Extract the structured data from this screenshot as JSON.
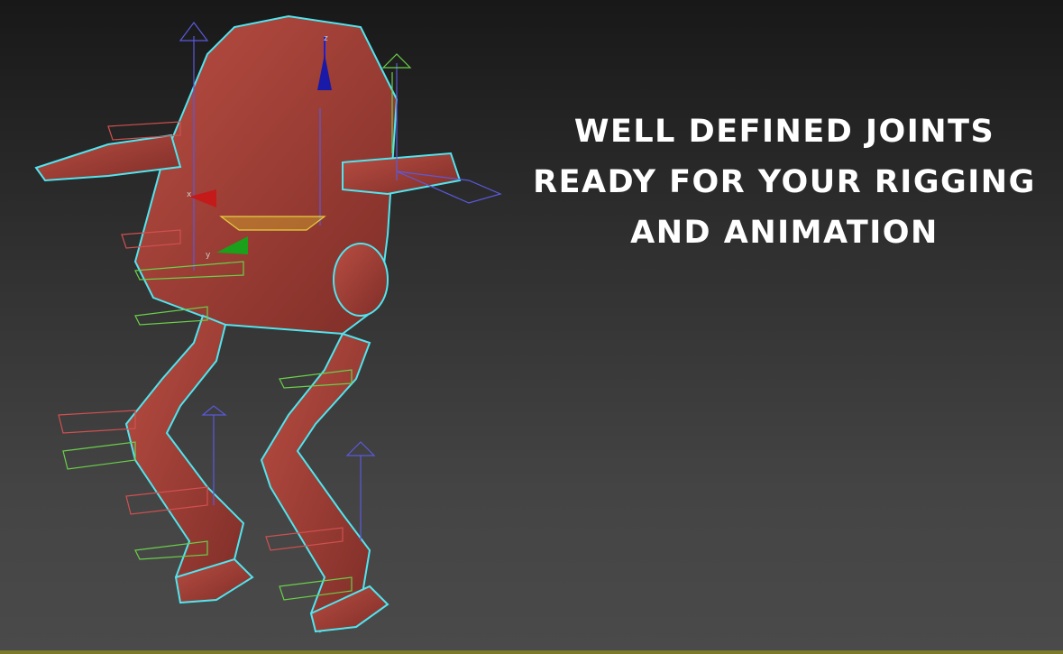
{
  "headline": {
    "lines": [
      "WELL DEFINED JOINTS",
      "READY FOR YOUR RIGGING",
      "AND ANIMATION"
    ]
  },
  "colors": {
    "model": "#a8433a",
    "selection_outline": "#4fe6f0",
    "bone_blue": "#5a5adc",
    "bone_green": "#6ad04a",
    "bone_red": "#d05050",
    "bottom_line": "#7a7a2a"
  },
  "gizmo": {
    "x_label": "x",
    "y_label": "y",
    "z_label": "z"
  }
}
